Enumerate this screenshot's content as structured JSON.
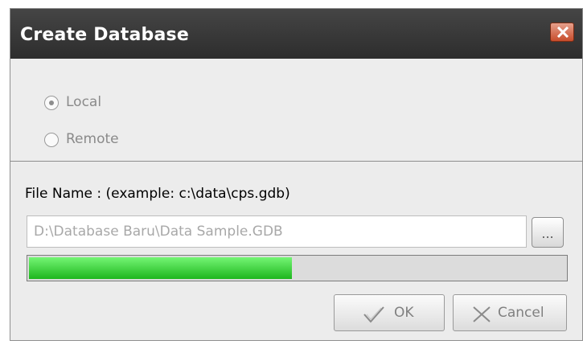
{
  "dialog": {
    "title": "Create Database",
    "close_icon": "close-icon"
  },
  "connection": {
    "local_label": "Local",
    "remote_label": "Remote",
    "selected": "Local"
  },
  "file": {
    "label": "File Name :  (example: c:\\data\\cps.gdb)",
    "value": "D:\\Database Baru\\Data Sample.GDB",
    "browse_label": "..."
  },
  "progress": {
    "fraction": 0.49,
    "fill_color": "#1eb61e"
  },
  "buttons": {
    "ok_label": "OK",
    "cancel_label": "Cancel"
  }
}
